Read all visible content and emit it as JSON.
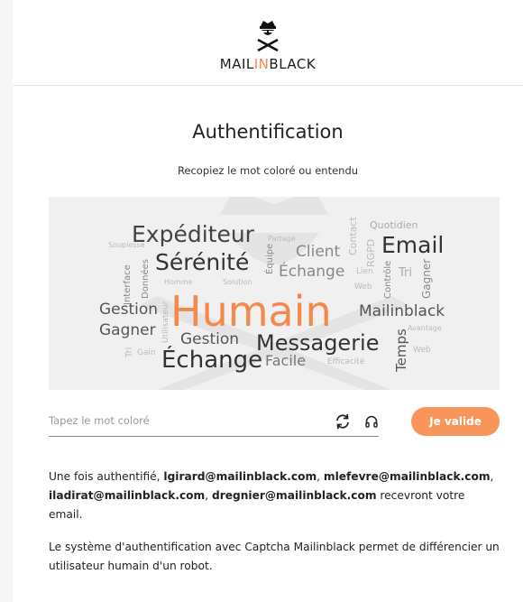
{
  "brand": {
    "prefix": "MAIL",
    "in": "IN",
    "suffix": "BLACK"
  },
  "page_title": "Authentification",
  "instruction": "Recopiez le mot coloré ou entendu",
  "captcha": {
    "words": [
      {
        "text": "Expéditeur"
      },
      {
        "text": "Sérénité"
      },
      {
        "text": "Client"
      },
      {
        "text": "Email"
      },
      {
        "text": "Échange"
      },
      {
        "text": "Quotidien"
      },
      {
        "text": "Contact"
      },
      {
        "text": "RGPD"
      },
      {
        "text": "Partage"
      },
      {
        "text": "Souplesse"
      },
      {
        "text": "Interface"
      },
      {
        "text": "Données"
      },
      {
        "text": "Équipe"
      },
      {
        "text": "Lien"
      },
      {
        "text": "Web"
      },
      {
        "text": "Contrôle"
      },
      {
        "text": "Tri"
      },
      {
        "text": "Gagner"
      },
      {
        "text": "Homme"
      },
      {
        "text": "Solution"
      },
      {
        "text": "Gestion"
      },
      {
        "text": "Utilisateur"
      },
      {
        "text": "Humain"
      },
      {
        "text": "Mailinblack"
      },
      {
        "text": "Avantage"
      },
      {
        "text": "Gagner"
      },
      {
        "text": "Gestion"
      },
      {
        "text": "Messagerie"
      },
      {
        "text": "Temps"
      },
      {
        "text": "Tri"
      },
      {
        "text": "Gain"
      },
      {
        "text": "Échange"
      },
      {
        "text": "Facile"
      },
      {
        "text": "Efficacité"
      },
      {
        "text": "Web"
      }
    ],
    "colored_word_color": "#f5894c"
  },
  "form": {
    "placeholder": "Tapez le mot coloré",
    "refresh_icon": "refresh-icon",
    "audio_icon": "headphones-icon",
    "submit_label": "Je valide",
    "submit_color": "#f7955a"
  },
  "info1": {
    "prefix": "Une fois authentifié, ",
    "recipients": [
      "lgirard@mailinblack.com",
      "mlefevre@mailinblack.com",
      "iladirat@mailinblack.com",
      "dregnier@mailinblack.com"
    ],
    "sep": ", ",
    "suffix": " recevront votre email."
  },
  "info2": "Le système d'authentification avec Captcha Mailinblack permet de différencier un utilisateur humain d'un robot."
}
